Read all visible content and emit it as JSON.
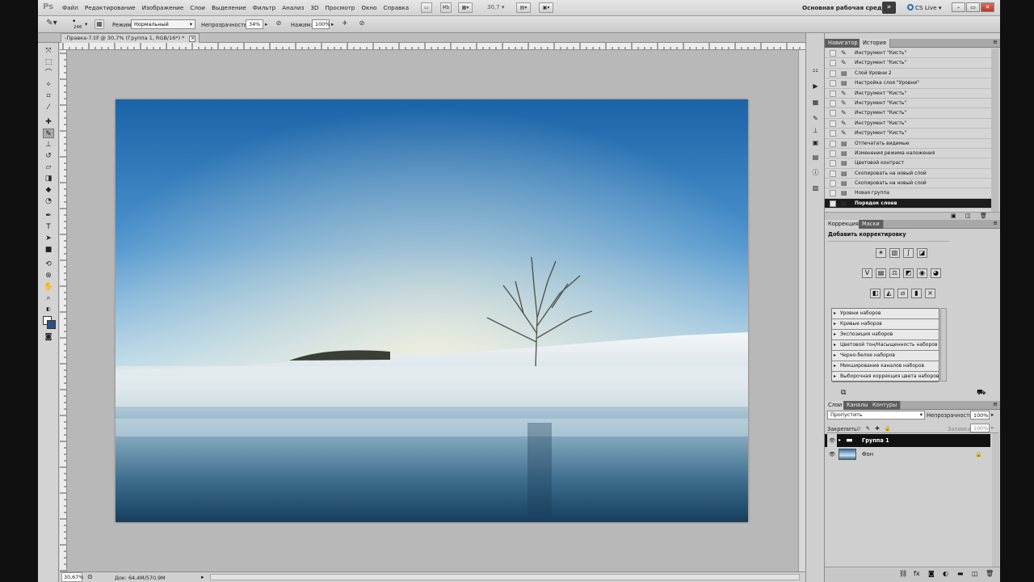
{
  "menubar": {
    "logo": "Ps",
    "items": [
      "Файл",
      "Редактирование",
      "Изображение",
      "Слои",
      "Выделение",
      "Фильтр",
      "Анализ",
      "3D",
      "Просмотр",
      "Окно",
      "Справка"
    ],
    "zoom": "30,7",
    "workspace": "Основная рабочая среда",
    "workspace_more": "»",
    "cslive": "CS Live"
  },
  "options": {
    "brush_size": "246",
    "mode_label": "Режим:",
    "mode_value": "Нормальный",
    "opacity_label": "Непрозрачность:",
    "opacity_value": "34%",
    "pressure_label": "Нажим:",
    "pressure_value": "100%"
  },
  "document": {
    "tab_title": "-Правка-7.tif @ 30,7% (Группа 1, RGB/16*) *",
    "zoom": "30,67%",
    "doc_info": "Док: 64,4M/570,9M"
  },
  "history": {
    "tabs": [
      "Навигатор",
      "История"
    ],
    "active_tab": "История",
    "items": [
      "Инструмент \"Кисть\"",
      "Инструмент \"Кисть\"",
      "Слой Уровни 2",
      "Настройка слоя \"Уровни\"",
      "Инструмент \"Кисть\"",
      "Инструмент \"Кисть\"",
      "Инструмент \"Кисть\"",
      "Инструмент \"Кисть\"",
      "Инструмент \"Кисть\"",
      "Отпечатать видимые",
      "Изменения режима наложения",
      "Цветовой контраст",
      "Скопировать на новый слой",
      "Скопировать на новый слой",
      "Новая группа",
      "Порядок слоев"
    ],
    "selected_index": 15
  },
  "adjustments": {
    "tabs": [
      "Коррекция",
      "Маски"
    ],
    "subtitle": "Добавить корректировку",
    "presets": [
      "Уровни наборов",
      "Кривые наборов",
      "Экспозиция наборов",
      "Цветовой тон/Насыщенность наборов",
      "Черно-белое наборов",
      "Микширование каналов наборов",
      "Выборочная коррекция цвета наборов"
    ]
  },
  "layers": {
    "tabs": [
      "Слои",
      "Каналы",
      "Контуры"
    ],
    "blend_mode": "Пропустить",
    "opacity_label": "Непрозрачность:",
    "opacity_value": "100%",
    "lock_label": "Закрепить:",
    "fill_label": "Заливка:",
    "fill_value": "100%",
    "items": [
      {
        "name": "Группа 1",
        "selected": true
      },
      {
        "name": "Фон",
        "selected": false
      }
    ]
  },
  "colors": {
    "accent_selected": "#1b1b1b",
    "cslive_blue": "#1e73be"
  }
}
